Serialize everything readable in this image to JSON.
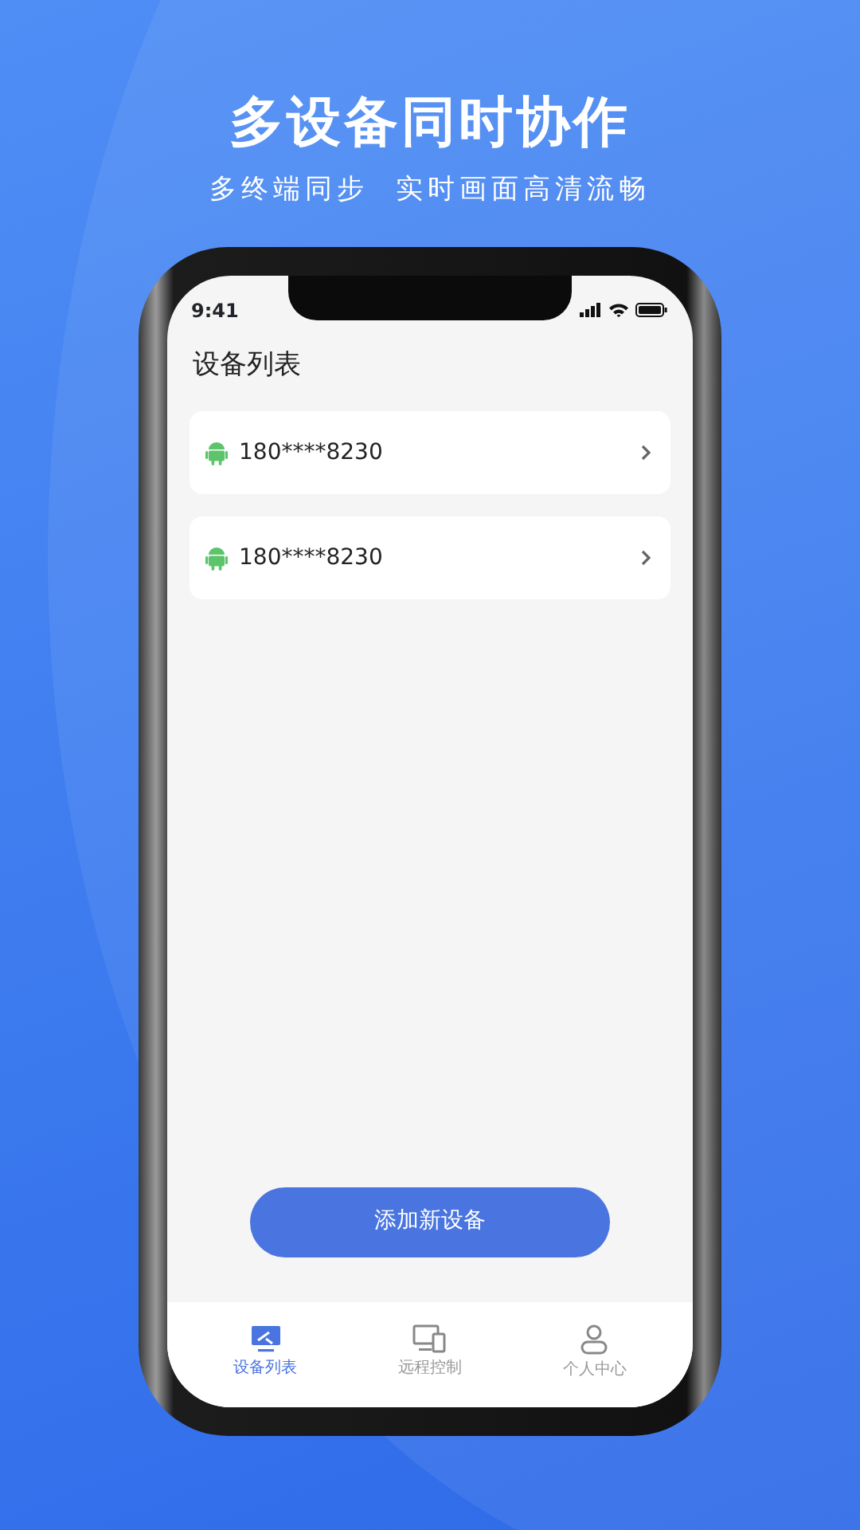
{
  "headline": "多设备同时协作",
  "subtitle": "多终端同步  实时画面高清流畅",
  "status_bar": {
    "time": "9:41"
  },
  "page_title": "设备列表",
  "devices": [
    {
      "name": "180****8230"
    },
    {
      "name": "180****8230"
    }
  ],
  "add_button": "添加新设备",
  "tabs": [
    {
      "kind": "devices",
      "label": "设备列表",
      "selected": true
    },
    {
      "kind": "remote",
      "label": "远程控制",
      "selected": false
    },
    {
      "kind": "profile",
      "label": "个人中心",
      "selected": false
    }
  ]
}
